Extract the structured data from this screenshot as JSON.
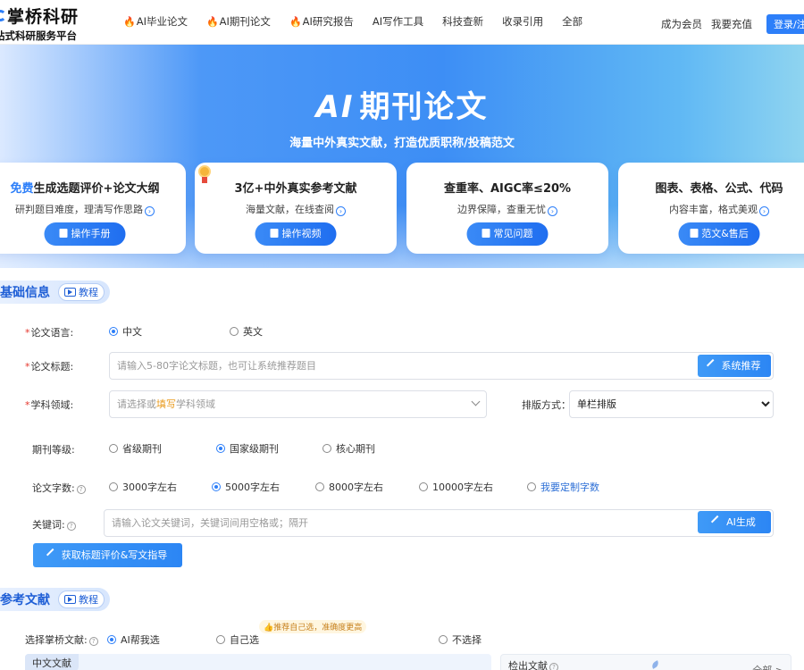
{
  "header": {
    "logo_main": "掌桥科研",
    "logo_sub": "站式科研服务平台",
    "nav": [
      "AI毕业论文",
      "AI期刊论文",
      "AI研究报告",
      "AI写作工具",
      "科技查新",
      "收录引用",
      "全部"
    ],
    "nav_hot": [
      true,
      true,
      true,
      false,
      false,
      false,
      false
    ],
    "member": "成为会员",
    "recharge": "我要充值",
    "login": "登录/注册"
  },
  "banner": {
    "title_ai": "AI",
    "title_rest": "期刊论文",
    "subtitle": "海量中外真实文献，打造优质职称/投稿范文",
    "cards": [
      {
        "title_prefix": "免费",
        "title": "生成选题评价+论文大纲",
        "desc": "研判题目难度，理清写作思路",
        "button": "操作手册"
      },
      {
        "title_prefix": "",
        "title": "3亿+中外真实参考文献",
        "desc": "海量文献，在线查阅",
        "button": "操作视频"
      },
      {
        "title_prefix": "",
        "title": "查重率、AIGC率≤20%",
        "desc": "边界保障，查重无忧",
        "button": "常见问题"
      },
      {
        "title_prefix": "",
        "title": "图表、表格、公式、代码",
        "desc": "内容丰富，格式美观",
        "button": "范文&售后"
      }
    ]
  },
  "basic": {
    "title": "基础信息",
    "tutorial": "教程",
    "language_label": "论文语言:",
    "language_options": [
      "中文",
      "英文"
    ],
    "title_label": "论文标题:",
    "title_placeholder": "请输入5-80字论文标题，也可让系统推荐题目",
    "recommend_button": "系统推荐",
    "field_label": "学科领域:",
    "field_placeholder_a": "请选择或",
    "field_placeholder_hl": "填写",
    "field_placeholder_b": "学科领域",
    "layout_label": "排版方式：",
    "layout_value": "单栏排版",
    "level_label": "期刊等级:",
    "level_options": [
      "省级期刊",
      "国家级期刊",
      "核心期刊"
    ],
    "count_label": "论文字数:",
    "count_options": [
      "3000字左右",
      "5000字左右",
      "8000字左右",
      "10000字左右"
    ],
    "count_custom": "我要定制字数",
    "keywords_label": "关键词:",
    "keywords_placeholder": "请输入论文关键词，关键词间用空格或；隔开",
    "ai_generate": "AI生成",
    "guide_button": "获取标题评价&写文指导"
  },
  "references": {
    "title": "参考文献",
    "tutorial": "教程",
    "select_label": "选择掌桥文献:",
    "options": [
      "AI帮我选",
      "自己选",
      "不选择"
    ],
    "tip": "推荐自己选，准确度更高",
    "left_tab": "中文文献",
    "right_title": "检出文献",
    "right_all": "全部 >"
  },
  "colors": {
    "accent": "#2d7ff9",
    "required": "#e5352b",
    "highlight": "#e89a1e"
  }
}
